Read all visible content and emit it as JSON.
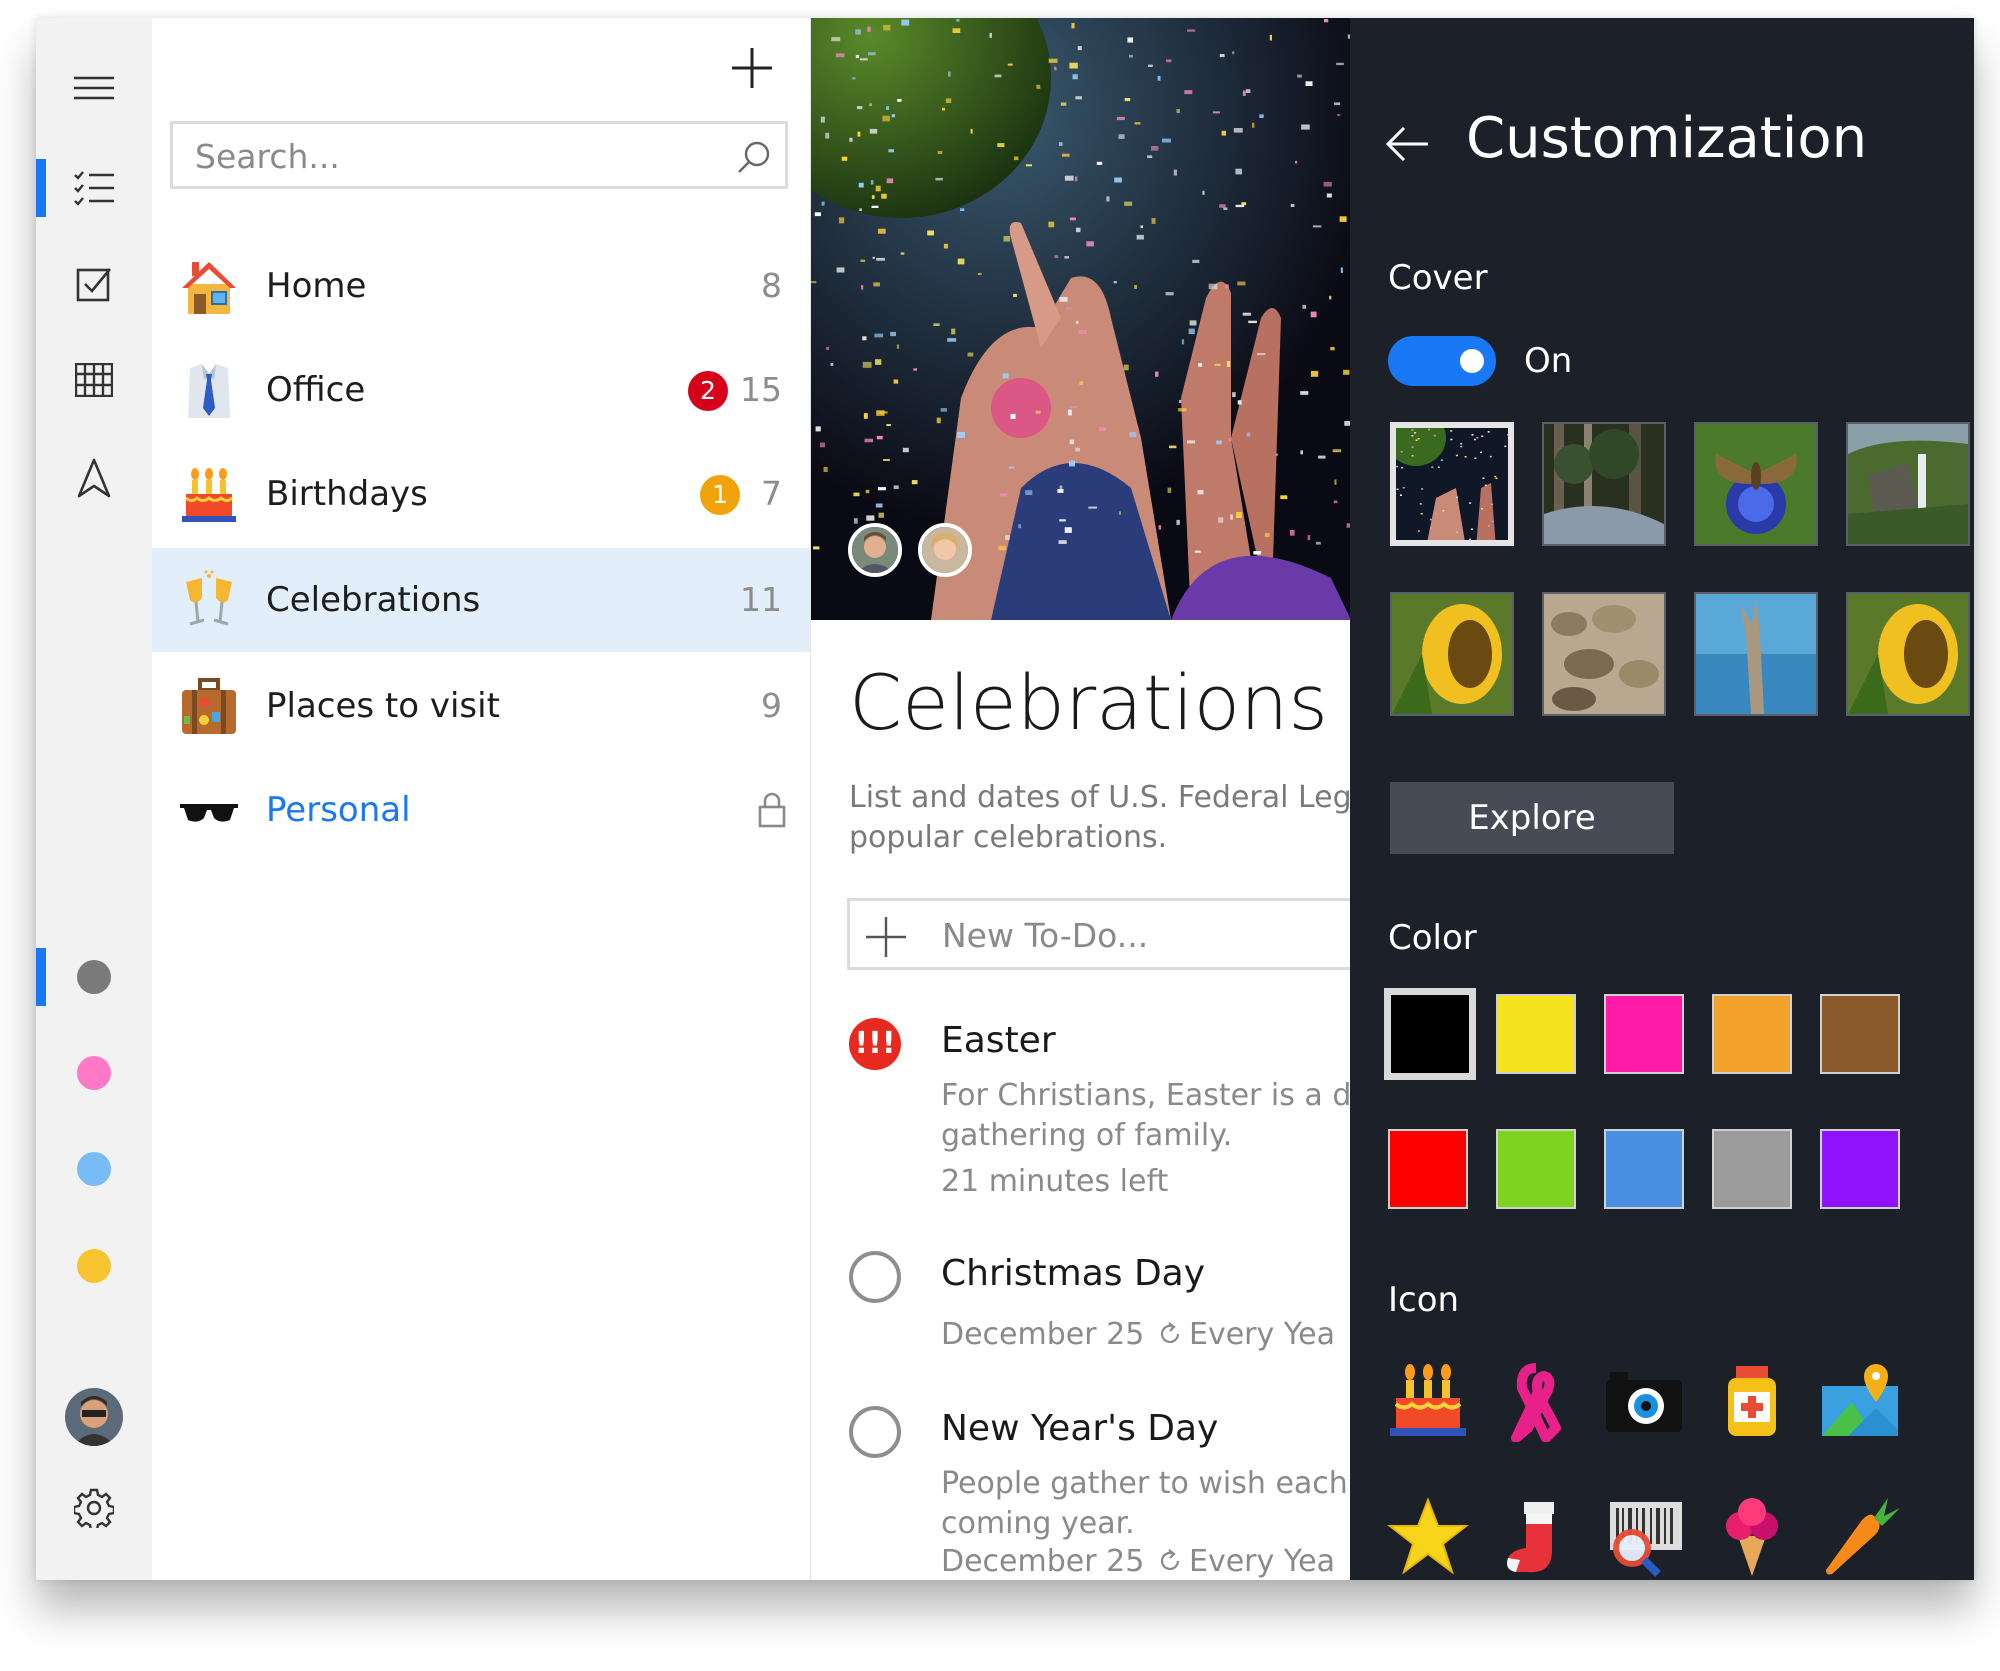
{
  "rail": {
    "items": [
      {
        "icon": "hamburger-menu-icon"
      },
      {
        "icon": "lists-icon",
        "selected": true
      },
      {
        "icon": "checkbox-icon"
      },
      {
        "icon": "calendar-grid-icon"
      },
      {
        "icon": "navigate-arrow-icon"
      }
    ],
    "tags": [
      {
        "color": "#7a7a7a",
        "selected": true
      },
      {
        "color": "#ff79c6"
      },
      {
        "color": "#78bcf5"
      },
      {
        "color": "#f8c530"
      }
    ],
    "bottom": [
      {
        "icon": "user-avatar"
      },
      {
        "icon": "gear-icon"
      }
    ]
  },
  "list": {
    "add_icon": "plus-icon",
    "search_placeholder": "Search...",
    "items": [
      {
        "label": "Home",
        "count": "8",
        "icon": "house-icon"
      },
      {
        "label": "Office",
        "count": "15",
        "badge": "2",
        "badge_color": "#d6001c",
        "icon": "shirt-tie-icon"
      },
      {
        "label": "Birthdays",
        "count": "7",
        "badge": "1",
        "badge_color": "#f0a30a",
        "icon": "birthday-cake-icon"
      },
      {
        "label": "Celebrations",
        "count": "11",
        "icon": "champagne-glasses-icon",
        "active": true
      },
      {
        "label": "Places to visit",
        "count": "9",
        "icon": "suitcase-icon"
      },
      {
        "label": "Personal",
        "icon": "sunglasses-icon",
        "locked": true,
        "label_color": "#1978f5"
      }
    ]
  },
  "detail": {
    "title": "Celebrations",
    "description": "List and dates of U.S. Federal Lega\npopular celebrations.",
    "new_todo_placeholder": "New To-Do...",
    "todos": [
      {
        "title": "Easter",
        "priority": "!!!",
        "notes": "For Christians, Easter is a da\ngathering of family.",
        "meta": "21 minutes left"
      },
      {
        "title": "Christmas Day",
        "date": "December 25",
        "repeat": "Every Yea"
      },
      {
        "title": "New Year's Day",
        "notes": "People gather to wish each\ncoming year.",
        "date": "December 25",
        "repeat": "Every Yea"
      }
    ]
  },
  "customization": {
    "title": "Customization",
    "cover_label": "Cover",
    "toggle_label": "On",
    "cover_on": true,
    "covers": [
      "confetti-party",
      "forest-stream",
      "moth-on-flower",
      "waterfall-cliffs",
      "sunflower",
      "river-rocks",
      "driftwood-lake",
      "sunflower"
    ],
    "explore_label": "Explore",
    "color_label": "Color",
    "colors": [
      "#000000",
      "#f5e31d",
      "#ff1aa8",
      "#f2a22a",
      "#8b5a2b",
      "#ff0000",
      "#7ed321",
      "#4a90e2",
      "#9b9b9b",
      "#9013fe"
    ],
    "icon_label": "Icon",
    "icons": [
      "birthday-cake-icon",
      "ribbon-icon",
      "camera-icon",
      "medicine-bottle-icon",
      "map-pin-icon",
      "star-icon",
      "stocking-icon",
      "barcode-search-icon",
      "ice-cream-icon",
      "carrot-icon"
    ]
  }
}
